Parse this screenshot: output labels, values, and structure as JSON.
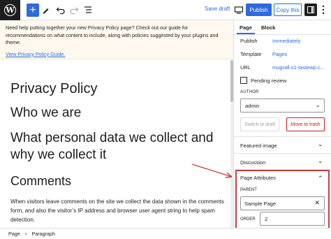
{
  "toolbar": {
    "logo_glyph": "W",
    "add_glyph": "+",
    "save_draft": "Save draft",
    "publish": "Publish",
    "copy_this": "Copy this"
  },
  "notice": {
    "text": "Need help putting together your new Privacy Policy page? Check out our guide for recommendations on what content to include, along with policies suggested by your plugins and theme.",
    "link": "View Privacy Policy Guide."
  },
  "editor": {
    "title": "Privacy Policy",
    "heading_1": "Who we are",
    "heading_2": "What personal data we collect and why we collect it",
    "heading_3": "Comments",
    "paragraph": "When visitors leave comments on the site we collect the data shown in the comments form, and also the visitor’s IP address and browser user agent string to help spam detection."
  },
  "breadcrumb": {
    "items": [
      "Page",
      "Paragraph"
    ],
    "separator": "›"
  },
  "sidebar": {
    "tabs": [
      "Page",
      "Block"
    ],
    "rows": [
      {
        "label": "Publish",
        "value": "Immediately"
      },
      {
        "label": "Template",
        "value": "Pages"
      },
      {
        "label": "URL",
        "value": "mugrall.s1-tastewp.c..."
      }
    ],
    "pending_review": "Pending review",
    "author_label": "AUTHOR",
    "author_value": "admin",
    "switch_to_draft": "Switch to draft",
    "move_to_trash": "Move to trash",
    "panels": [
      "Featured image",
      "Discussion",
      "Page Attributes"
    ],
    "parent_label": "PARENT",
    "parent_value": "Sample Page",
    "order_label": "ORDER",
    "order_value": "2"
  },
  "colors": {
    "accent": "#2c6ae0",
    "danger": "#cc1818",
    "highlight": "#c14141",
    "notice_bg": "#fef8ee"
  }
}
